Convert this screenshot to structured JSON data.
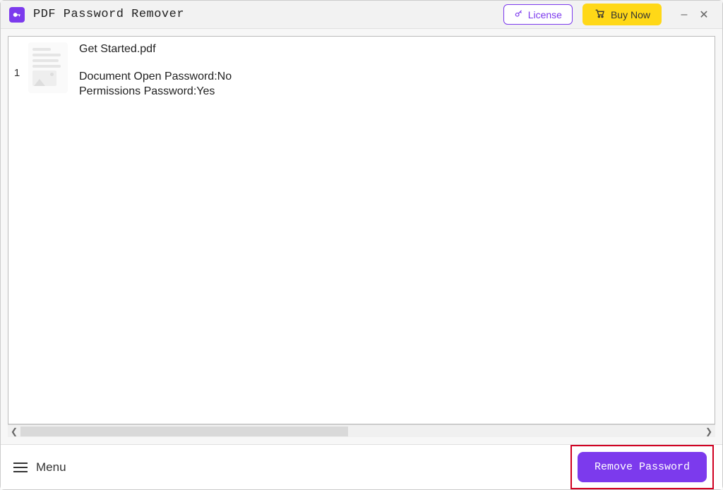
{
  "header": {
    "app_title": "PDF Password Remover",
    "license_label": "License",
    "buy_now_label": "Buy Now"
  },
  "files": [
    {
      "index": "1",
      "name": "Get Started.pdf",
      "doc_open_label": "Document Open Password:",
      "doc_open_value": "No",
      "permissions_label": "Permissions Password:",
      "permissions_value": "Yes"
    }
  ],
  "footer": {
    "menu_label": "Menu",
    "remove_label": "Remove Password"
  }
}
